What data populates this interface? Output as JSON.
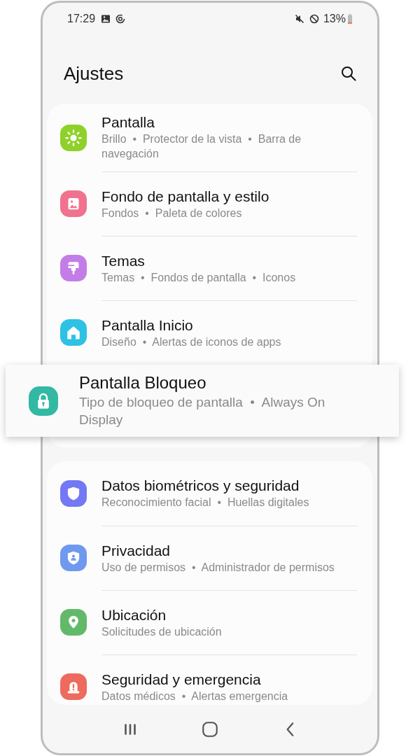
{
  "status_bar": {
    "time": "17:29",
    "battery": "13%"
  },
  "header": {
    "title": "Ajustes"
  },
  "groups": [
    {
      "items": [
        {
          "title": "Pantalla",
          "subtitle": "Brillo  •  Protector de la vista  •  Barra de navegación",
          "kind": "sun",
          "color": "#8fd12a",
          "highlighted": false
        },
        {
          "title": "Fondo de pantalla y estilo",
          "subtitle": "Fondos  •  Paleta de colores",
          "kind": "image",
          "color": "#f0728f",
          "highlighted": false
        },
        {
          "title": "Temas",
          "subtitle": "Temas  •  Fondos de pantalla  •  Iconos",
          "kind": "brush",
          "color": "#c27ee6",
          "highlighted": false
        },
        {
          "title": "Pantalla Inicio",
          "subtitle": "Diseño  •  Alertas de iconos de apps",
          "kind": "home",
          "color": "#2dc2e4",
          "highlighted": false
        },
        {
          "title": "Pantalla Bloqueo",
          "subtitle": "Tipo de bloqueo de pantalla  •  Always On Display",
          "kind": "lock",
          "color": "#33b8a4",
          "highlighted": true
        }
      ]
    },
    {
      "items": [
        {
          "title": "Datos biométricos y seguridad",
          "subtitle": "Reconocimiento facial  •  Huellas digitales",
          "kind": "shield",
          "color": "#7378f5",
          "highlighted": false
        },
        {
          "title": "Privacidad",
          "subtitle": "Uso de permisos  •  Administrador de permisos",
          "kind": "shield-person",
          "color": "#6f99ef",
          "highlighted": false
        },
        {
          "title": "Ubicación",
          "subtitle": "Solicitudes de ubicación",
          "kind": "pin",
          "color": "#63b96a",
          "highlighted": false
        },
        {
          "title": "Seguridad y emergencia",
          "subtitle": "Datos médicos  •  Alertas emergencia",
          "kind": "alert",
          "color": "#ee6a5e",
          "highlighted": false
        }
      ]
    }
  ]
}
